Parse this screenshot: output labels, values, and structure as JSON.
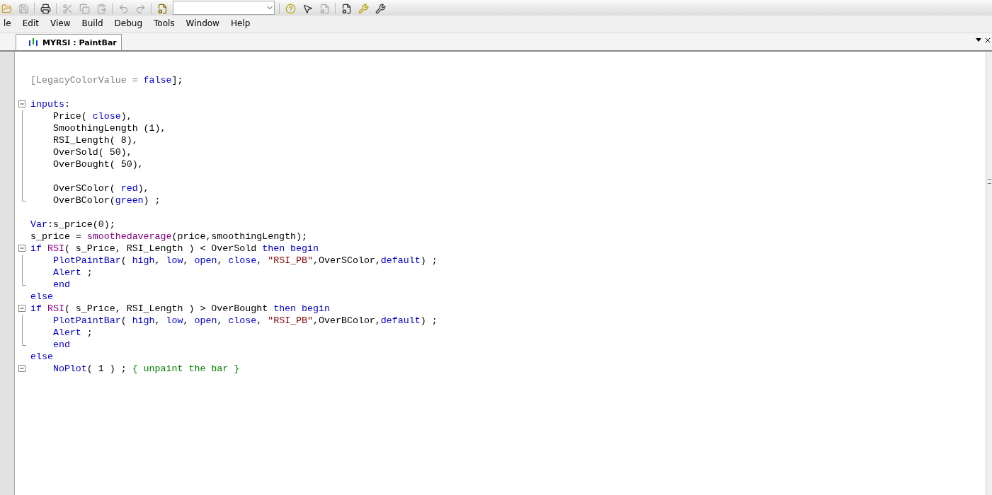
{
  "menu": [
    {
      "label": "le"
    },
    {
      "label": "Edit"
    },
    {
      "label": "View"
    },
    {
      "label": "Build"
    },
    {
      "label": "Debug"
    },
    {
      "label": "Tools"
    },
    {
      "label": "Window"
    },
    {
      "label": "Help"
    }
  ],
  "tabs": [
    {
      "label": "MYRSI : PaintBar",
      "selected": true
    }
  ],
  "code": [
    {
      "kind": "plain",
      "tokens": [
        {
          "kind": "gray",
          "t": "[LegacyColorValue = "
        },
        {
          "kind": "keyword",
          "t": "false"
        },
        {
          "kind": "plain",
          "t": "];"
        }
      ]
    },
    {
      "kind": "plain"
    },
    {
      "kind": "fold-start",
      "tokens": [
        {
          "kind": "keyword",
          "t": "inputs"
        },
        {
          "kind": "plain",
          "t": ":"
        }
      ]
    },
    {
      "kind": "fold-body",
      "tokens": [
        {
          "kind": "plain",
          "t": "    Price( "
        },
        {
          "kind": "keyword",
          "t": "close"
        },
        {
          "kind": "plain",
          "t": "),"
        }
      ]
    },
    {
      "kind": "fold-body",
      "tokens": [
        {
          "kind": "plain",
          "t": "    SmoothingLength (1),"
        }
      ]
    },
    {
      "kind": "fold-body",
      "tokens": [
        {
          "kind": "plain",
          "t": "    RSI_Length( 8),"
        }
      ]
    },
    {
      "kind": "fold-body",
      "tokens": [
        {
          "kind": "plain",
          "t": "    OverSold( 50),"
        }
      ]
    },
    {
      "kind": "fold-body",
      "tokens": [
        {
          "kind": "plain",
          "t": "    OverBought( 50),"
        }
      ]
    },
    {
      "kind": "fold-body"
    },
    {
      "kind": "fold-body",
      "tokens": [
        {
          "kind": "plain",
          "t": "    OverSColor( "
        },
        {
          "kind": "keyword",
          "t": "red"
        },
        {
          "kind": "plain",
          "t": "),"
        }
      ]
    },
    {
      "kind": "fold-end",
      "tokens": [
        {
          "kind": "plain",
          "t": "    OverBColor("
        },
        {
          "kind": "keyword",
          "t": "green"
        },
        {
          "kind": "plain",
          "t": ") ;"
        }
      ]
    },
    {
      "kind": "plain"
    },
    {
      "kind": "plain",
      "tokens": [
        {
          "kind": "keyword",
          "t": "Var"
        },
        {
          "kind": "plain",
          "t": ":s_price(0);"
        }
      ]
    },
    {
      "kind": "plain",
      "tokens": [
        {
          "kind": "plain",
          "t": "s_price = "
        },
        {
          "kind": "function",
          "t": "smoothedaverage"
        },
        {
          "kind": "plain",
          "t": "(price,smoothingLength);"
        }
      ]
    },
    {
      "kind": "fold-start",
      "tokens": [
        {
          "kind": "keyword",
          "t": "if "
        },
        {
          "kind": "function",
          "t": "RSI"
        },
        {
          "kind": "plain",
          "t": "( s_Price, RSI_Length ) < OverSold "
        },
        {
          "kind": "keyword",
          "t": "then begin"
        }
      ]
    },
    {
      "kind": "fold-body",
      "tokens": [
        {
          "kind": "keyword",
          "t": "    PlotPaintBar"
        },
        {
          "kind": "plain",
          "t": "( "
        },
        {
          "kind": "keyword",
          "t": "high"
        },
        {
          "kind": "plain",
          "t": ", "
        },
        {
          "kind": "keyword",
          "t": "low"
        },
        {
          "kind": "plain",
          "t": ", "
        },
        {
          "kind": "keyword",
          "t": "open"
        },
        {
          "kind": "plain",
          "t": ", "
        },
        {
          "kind": "keyword",
          "t": "close"
        },
        {
          "kind": "plain",
          "t": ", "
        },
        {
          "kind": "string",
          "t": "\"RSI_PB\""
        },
        {
          "kind": "plain",
          "t": ",OverSColor,"
        },
        {
          "kind": "keyword",
          "t": "default"
        },
        {
          "kind": "plain",
          "t": ") ;"
        }
      ]
    },
    {
      "kind": "fold-body",
      "tokens": [
        {
          "kind": "keyword",
          "t": "    Alert"
        },
        {
          "kind": "plain",
          "t": " ;"
        }
      ]
    },
    {
      "kind": "fold-end",
      "tokens": [
        {
          "kind": "keyword",
          "t": "    end"
        }
      ]
    },
    {
      "kind": "plain",
      "tokens": [
        {
          "kind": "keyword",
          "t": "else"
        }
      ]
    },
    {
      "kind": "fold-start",
      "tokens": [
        {
          "kind": "keyword",
          "t": "if "
        },
        {
          "kind": "function",
          "t": "RSI"
        },
        {
          "kind": "plain",
          "t": "( s_Price, RSI_Length ) > OverBought "
        },
        {
          "kind": "keyword",
          "t": "then begin"
        }
      ]
    },
    {
      "kind": "fold-body",
      "tokens": [
        {
          "kind": "keyword",
          "t": "    PlotPaintBar"
        },
        {
          "kind": "plain",
          "t": "( "
        },
        {
          "kind": "keyword",
          "t": "high"
        },
        {
          "kind": "plain",
          "t": ", "
        },
        {
          "kind": "keyword",
          "t": "low"
        },
        {
          "kind": "plain",
          "t": ", "
        },
        {
          "kind": "keyword",
          "t": "open"
        },
        {
          "kind": "plain",
          "t": ", "
        },
        {
          "kind": "keyword",
          "t": "close"
        },
        {
          "kind": "plain",
          "t": ", "
        },
        {
          "kind": "string",
          "t": "\"RSI_PB\""
        },
        {
          "kind": "plain",
          "t": ",OverBColor,"
        },
        {
          "kind": "keyword",
          "t": "default"
        },
        {
          "kind": "plain",
          "t": ") ;"
        }
      ]
    },
    {
      "kind": "fold-body",
      "tokens": [
        {
          "kind": "keyword",
          "t": "    Alert"
        },
        {
          "kind": "plain",
          "t": " ;"
        }
      ]
    },
    {
      "kind": "fold-end",
      "tokens": [
        {
          "kind": "keyword",
          "t": "    end"
        }
      ]
    },
    {
      "kind": "plain",
      "tokens": [
        {
          "kind": "keyword",
          "t": "else"
        }
      ]
    },
    {
      "kind": "fold-start",
      "tokens": [
        {
          "kind": "keyword",
          "t": "    NoPlot"
        },
        {
          "kind": "plain",
          "t": "( 1 ) ; "
        },
        {
          "kind": "comment",
          "t": "{ unpaint the bar }"
        }
      ]
    }
  ]
}
